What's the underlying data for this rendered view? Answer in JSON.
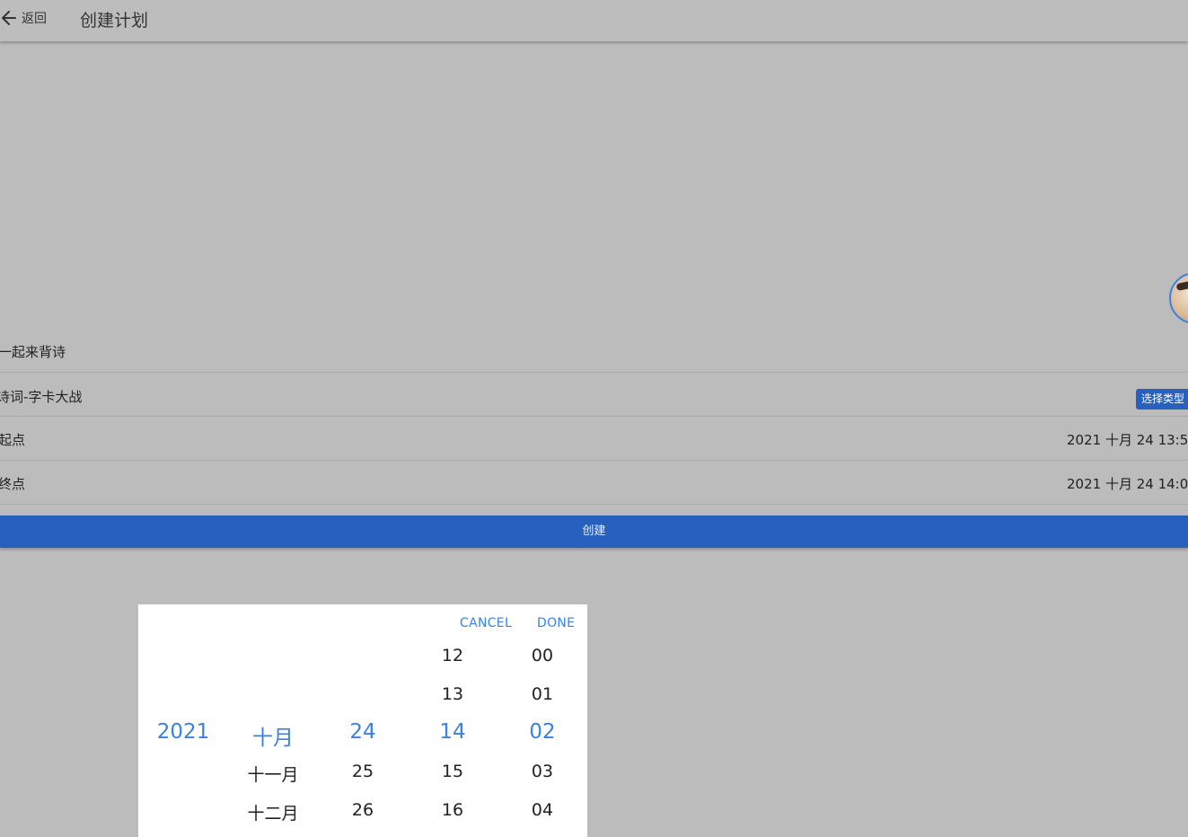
{
  "header": {
    "back_label": "返回",
    "title": "创建计划"
  },
  "form": {
    "name_value": "一起来背诗",
    "type_value": "诗词-字卡大战",
    "type_button": "选择类型",
    "start_label": "起点",
    "start_value": "2021 十月 24 13:5",
    "end_label": "终点",
    "end_value": "2021 十月 24 14:0"
  },
  "create_button": "创建",
  "picker": {
    "cancel": "CANCEL",
    "done": "DONE",
    "year": {
      "items": [
        "2021"
      ]
    },
    "month": {
      "items": [
        "十月",
        "十一月",
        "十二月"
      ]
    },
    "day": {
      "items": [
        "24",
        "25",
        "26"
      ]
    },
    "hour": {
      "items": [
        "12",
        "13",
        "14",
        "15",
        "16"
      ]
    },
    "minute": {
      "items": [
        "00",
        "01",
        "02",
        "03",
        "04"
      ]
    }
  },
  "colors": {
    "accent": "#3a82e0",
    "primary_button": "#2860c0",
    "overlay": "#bcbcbc"
  }
}
